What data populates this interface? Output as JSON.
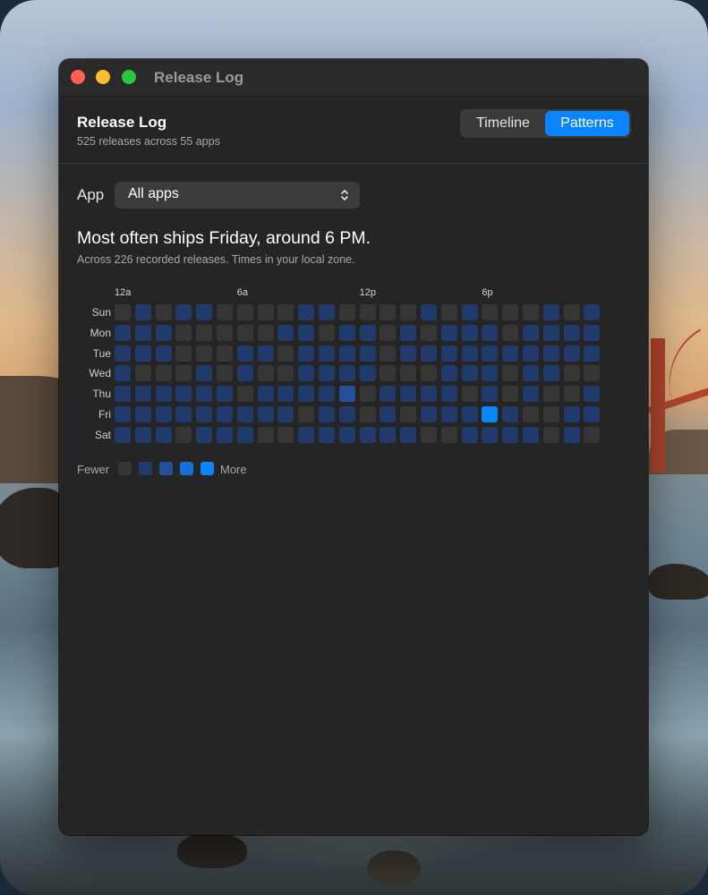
{
  "window": {
    "title": "Release Log"
  },
  "header": {
    "title": "Release Log",
    "subtitle": "525 releases across 55 apps",
    "tabs": [
      {
        "label": "Timeline",
        "selected": false
      },
      {
        "label": "Patterns",
        "selected": true
      }
    ]
  },
  "filter": {
    "label": "App",
    "value": "All apps",
    "icon": "chevron-up-down-icon"
  },
  "summary": {
    "headline": "Most often ships Friday, around 6 PM.",
    "detail": "Across 226 recorded releases. Times in your local zone."
  },
  "colors": {
    "accent": "#0a84ff",
    "levels": [
      "#363636",
      "#1f3a6b",
      "#24509a",
      "#1a6fd6",
      "#0a84ff"
    ]
  },
  "chart_data": {
    "type": "heatmap",
    "x_tick_labels": [
      "12a",
      "6a",
      "12p",
      "6p"
    ],
    "x_tick_hours": [
      0,
      6,
      12,
      18
    ],
    "days": [
      "Sun",
      "Mon",
      "Tue",
      "Wed",
      "Thu",
      "Fri",
      "Sat"
    ],
    "hours": [
      0,
      1,
      2,
      3,
      4,
      5,
      6,
      7,
      8,
      9,
      10,
      11,
      12,
      13,
      14,
      15,
      16,
      17,
      18,
      19,
      20,
      21,
      22,
      23
    ],
    "levels": [
      [
        0,
        1,
        0,
        1,
        1,
        0,
        0,
        0,
        0,
        1,
        1,
        0,
        0,
        0,
        0,
        1,
        0,
        1,
        0,
        0,
        0,
        1,
        0,
        1
      ],
      [
        1,
        1,
        1,
        0,
        0,
        0,
        0,
        0,
        1,
        1,
        0,
        1,
        1,
        0,
        1,
        0,
        1,
        1,
        1,
        0,
        1,
        1,
        1,
        1
      ],
      [
        1,
        1,
        1,
        0,
        0,
        0,
        1,
        1,
        0,
        1,
        1,
        1,
        1,
        0,
        1,
        1,
        1,
        1,
        1,
        1,
        1,
        1,
        1,
        1
      ],
      [
        1,
        0,
        0,
        0,
        1,
        0,
        1,
        0,
        0,
        1,
        1,
        1,
        1,
        0,
        0,
        0,
        1,
        1,
        1,
        0,
        1,
        1,
        0,
        0
      ],
      [
        1,
        1,
        1,
        1,
        1,
        1,
        0,
        1,
        1,
        1,
        1,
        2,
        0,
        1,
        1,
        1,
        1,
        0,
        1,
        0,
        1,
        0,
        0,
        1
      ],
      [
        1,
        1,
        1,
        1,
        1,
        1,
        1,
        1,
        1,
        0,
        1,
        1,
        0,
        1,
        0,
        1,
        1,
        1,
        4,
        1,
        0,
        0,
        1,
        1
      ],
      [
        1,
        1,
        1,
        0,
        1,
        1,
        1,
        0,
        0,
        1,
        1,
        1,
        1,
        1,
        1,
        0,
        0,
        1,
        1,
        1,
        1,
        0,
        1,
        0
      ]
    ],
    "legend": {
      "low_label": "Fewer",
      "high_label": "More",
      "levels": [
        0,
        1,
        2,
        3,
        4
      ]
    },
    "peak": {
      "day": "Fri",
      "hour": 18
    }
  }
}
